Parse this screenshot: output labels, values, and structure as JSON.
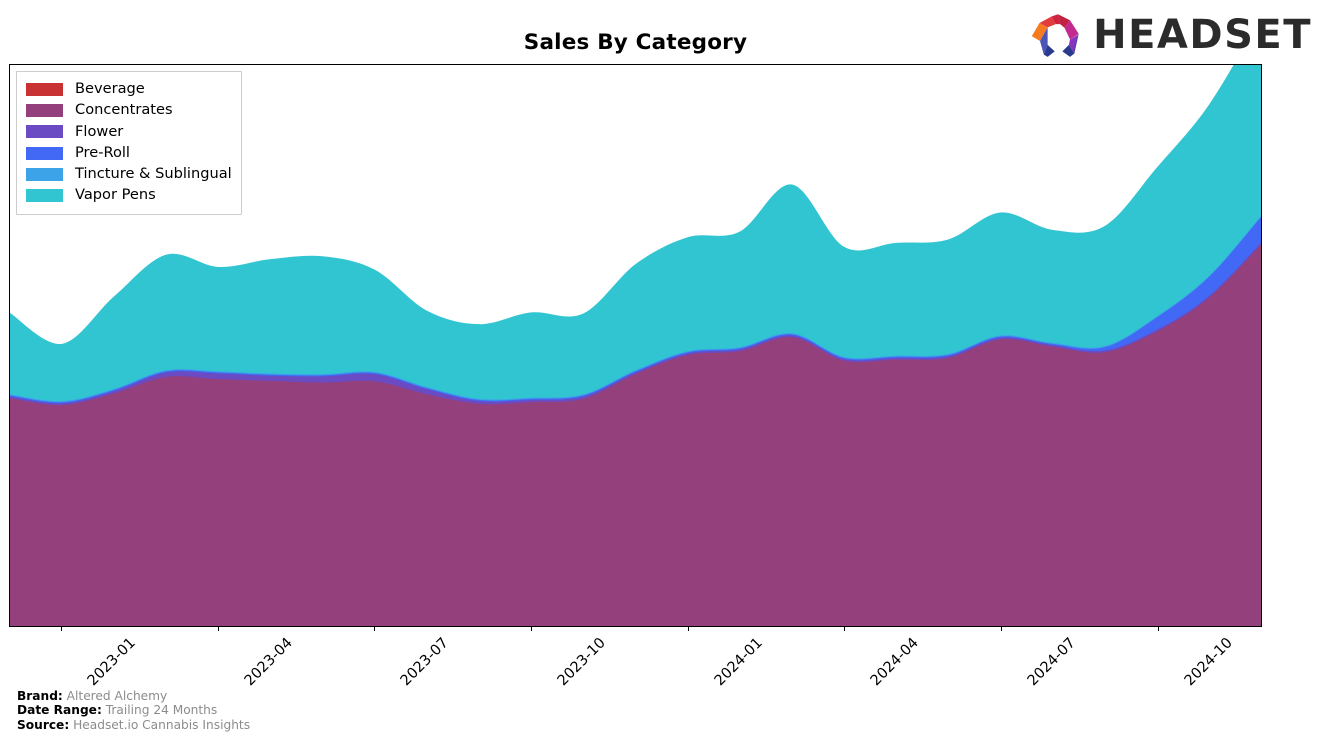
{
  "header": {
    "title": "Sales By Category",
    "logo_text": "HEADSET",
    "logo_icon": "headset-hexagon-logo"
  },
  "footer": {
    "rows": [
      {
        "key": "Brand:",
        "value": "Altered Alchemy"
      },
      {
        "key": "Date Range:",
        "value": "Trailing 24 Months"
      },
      {
        "key": "Source:",
        "value": "Headset.io Cannabis Insights"
      }
    ]
  },
  "legend": {
    "position": "upper-left",
    "items": [
      {
        "label": "Beverage",
        "color": "#c93232"
      },
      {
        "label": "Concentrates",
        "color": "#93407c"
      },
      {
        "label": "Flower",
        "color": "#6a4bc4"
      },
      {
        "label": "Pre-Roll",
        "color": "#4169f5"
      },
      {
        "label": "Tincture & Sublingual",
        "color": "#3da3e8"
      },
      {
        "label": "Vapor Pens",
        "color": "#31c5d1"
      }
    ]
  },
  "chart_data": {
    "type": "area",
    "stacked": true,
    "title": "Sales By Category",
    "xlabel": "",
    "ylabel": "",
    "grid": false,
    "legend_position": "upper left",
    "y_axis_visible": false,
    "ylim": [
      0,
      100
    ],
    "x": [
      "2022-12",
      "2023-01",
      "2023-02",
      "2023-03",
      "2023-04",
      "2023-05",
      "2023-06",
      "2023-07",
      "2023-08",
      "2023-09",
      "2023-10",
      "2023-11",
      "2023-12",
      "2024-01",
      "2024-02",
      "2024-03",
      "2024-04",
      "2024-05",
      "2024-06",
      "2024-07",
      "2024-08",
      "2024-09",
      "2024-10",
      "2024-11",
      "2024-12"
    ],
    "tick_labels": [
      "2023-01",
      "2023-04",
      "2023-07",
      "2023-10",
      "2024-01",
      "2024-04",
      "2024-07",
      "2024-10"
    ],
    "tick_index": [
      1,
      4,
      7,
      10,
      13,
      16,
      19,
      22
    ],
    "series": [
      {
        "name": "Beverage",
        "color": "#c93232",
        "values": [
          0.0,
          0.0,
          0.0,
          0.0,
          0.0,
          0.0,
          0.0,
          0.0,
          0.0,
          0.0,
          0.0,
          0.0,
          0.0,
          0.0,
          0.0,
          0.0,
          0.0,
          0.0,
          0.0,
          0.0,
          0.0,
          0.0,
          0.0,
          0.0,
          0.0
        ]
      },
      {
        "name": "Concentrates",
        "color": "#93407c",
        "values": [
          40.6,
          39.4,
          41.5,
          44.4,
          44.0,
          43.7,
          43.4,
          43.6,
          41.3,
          39.6,
          39.9,
          40.5,
          44.9,
          48.3,
          49.0,
          51.5,
          47.3,
          47.5,
          47.8,
          51.1,
          49.8,
          48.8,
          52.5,
          58.5,
          68.0
        ]
      },
      {
        "name": "Flower",
        "color": "#6a4bc4",
        "values": [
          0.3,
          0.3,
          0.4,
          0.8,
          1.0,
          0.9,
          1.1,
          1.3,
          0.9,
          0.5,
          0.4,
          0.4,
          0.3,
          0.3,
          0.3,
          0.3,
          0.3,
          0.3,
          0.3,
          0.3,
          0.3,
          0.3,
          0.3,
          0.3,
          0.3
        ]
      },
      {
        "name": "Pre-Roll",
        "color": "#4169f5",
        "values": [
          0.2,
          0.2,
          0.2,
          0.2,
          0.2,
          0.2,
          0.2,
          0.2,
          0.2,
          0.2,
          0.2,
          0.2,
          0.2,
          0.2,
          0.2,
          0.2,
          0.2,
          0.2,
          0.2,
          0.2,
          0.2,
          0.6,
          2.2,
          3.4,
          4.6
        ]
      },
      {
        "name": "Tincture & Sublingual",
        "color": "#3da3e8",
        "values": [
          0.2,
          0.2,
          0.2,
          0.2,
          0.2,
          0.2,
          0.2,
          0.2,
          0.2,
          0.2,
          0.2,
          0.2,
          0.2,
          0.2,
          0.2,
          0.2,
          0.2,
          0.2,
          0.2,
          0.2,
          0.2,
          0.2,
          0.2,
          0.2,
          0.2
        ]
      },
      {
        "name": "Vapor Pens",
        "color": "#31c5d1",
        "values": [
          14.5,
          10.2,
          16.5,
          20.6,
          18.6,
          20.4,
          21.0,
          18.2,
          13.6,
          13.3,
          15.2,
          14.4,
          18.9,
          20.3,
          20.6,
          26.5,
          19.6,
          20.1,
          20.4,
          21.9,
          20.1,
          21.4,
          26.5,
          30.5,
          35.5
        ]
      }
    ]
  }
}
